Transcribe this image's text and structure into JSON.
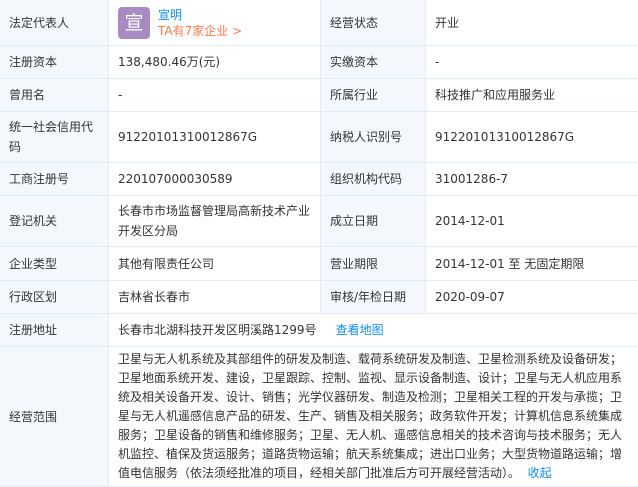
{
  "legal_rep": {
    "label": "法定代表人",
    "avatar_char": "宣",
    "name": "宣明",
    "companies_link": "TA有7家企业 >"
  },
  "rows": [
    {
      "l1": "注册资本",
      "v1": "138,480.46万(元)",
      "l2": "实缴资本",
      "v2": "-"
    },
    {
      "l1": "曾用名",
      "v1": "-",
      "l2": "所属行业",
      "v2": "科技推广和应用服务业"
    },
    {
      "l1": "统一社会信用代码",
      "v1": "91220101310012867G",
      "l2": "纳税人识别号",
      "v2": "91220101310012867G"
    },
    {
      "l1": "工商注册号",
      "v1": "220107000030589",
      "l2": "组织机构代码",
      "v2": "31001286-7"
    },
    {
      "l1": "登记机关",
      "v1": "长春市市场监督管理局高新技术产业开发区分局",
      "l2": "成立日期",
      "v2": "2014-12-01"
    },
    {
      "l1": "企业类型",
      "v1": "其他有限责任公司",
      "l2": "营业期限",
      "v2": "2014-12-01 至 无固定期限"
    },
    {
      "l1": "行政区划",
      "v1": "吉林省长春市",
      "l2": "审核/年检日期",
      "v2": "2020-09-07"
    }
  ],
  "status": {
    "label": "经营状态",
    "value": "开业"
  },
  "address": {
    "label": "注册地址",
    "value": "长春市北湖科技开发区明溪路1299号",
    "map_link": "查看地图"
  },
  "scope": {
    "label": "经营范围",
    "value": "卫星与无人机系统及其部组件的研发及制造、载荷系统研发及制造、卫星检测系统及设备研发；卫星地面系统开发、建设，卫星跟踪、控制、监视、显示设备制造、设计；卫星与无人机应用系统及相关设备开发、设计、销售；光学仪器研发、制造及检测；卫星相关工程的开发与承揽；卫星与无人机遥感信息产品的研发、生产、销售及相关服务；政务软件开发；计算机信息系统集成服务；卫星设备的销售和维修服务；卫星、无人机、遥感信息相关的技术咨询与技术服务；无人机监控、植保及货运服务；道路货物运输；航天系统集成；进出口业务；大型货物道路运输；增值电信服务（依法须经批准的项目，经相关部门批准后方可开展经营活动）。",
    "collapse_link": "收起"
  }
}
